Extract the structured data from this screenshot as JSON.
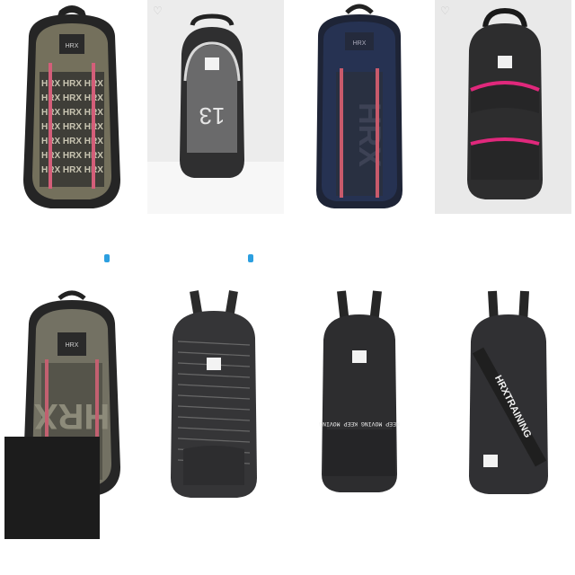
{
  "products": [
    {
      "brand": "",
      "title": "",
      "badge": "",
      "price": "",
      "mrp": "",
      "body": "#74705c",
      "accent": "#d45e79",
      "trim": "#2a2a2a",
      "print": "HRX"
    },
    {
      "brand": "",
      "title": "",
      "badge": "",
      "price": "",
      "mrp": "",
      "body": "#2f2f30",
      "accent": "#d8d8d8",
      "trim": "#555",
      "print": "13"
    },
    {
      "brand": "",
      "title": "",
      "badge": "",
      "price": "",
      "mrp": "",
      "body": "#263252",
      "accent": "#c85a6b",
      "trim": "#2b2b2b",
      "print": "HRX"
    },
    {
      "brand": "",
      "title": "",
      "badge": "",
      "price": "",
      "mrp": "",
      "body": "#2d2d2e",
      "accent": "#e0287c",
      "trim": "#1a1a1a",
      "print": ""
    },
    {
      "brand": "",
      "title": "",
      "badge": "",
      "price": "",
      "mrp": "",
      "body": "#737163",
      "accent": "#c26070",
      "trim": "#272727",
      "print": "HRX"
    },
    {
      "brand": "",
      "title": "",
      "badge": "",
      "price": "",
      "mrp": "",
      "body": "#353537",
      "accent": "#777",
      "trim": "#2a2a2a",
      "print": ""
    },
    {
      "brand": "",
      "title": "",
      "badge": "",
      "price": "",
      "mrp": "",
      "body": "#2d2d2f",
      "accent": "#f0f0f0",
      "trim": "#1f1f1f",
      "print": "KEEP MOVING KEEP MOVING"
    },
    {
      "brand": "",
      "title": "",
      "badge": "",
      "price": "",
      "mrp": "",
      "body": "#303033",
      "accent": "#f0f0f0",
      "trim": "#1f1f1f",
      "print": "HRXTRAINING"
    }
  ],
  "colors": {
    "badge": "#2c9fe0",
    "overlay": "#1c1c1c"
  }
}
